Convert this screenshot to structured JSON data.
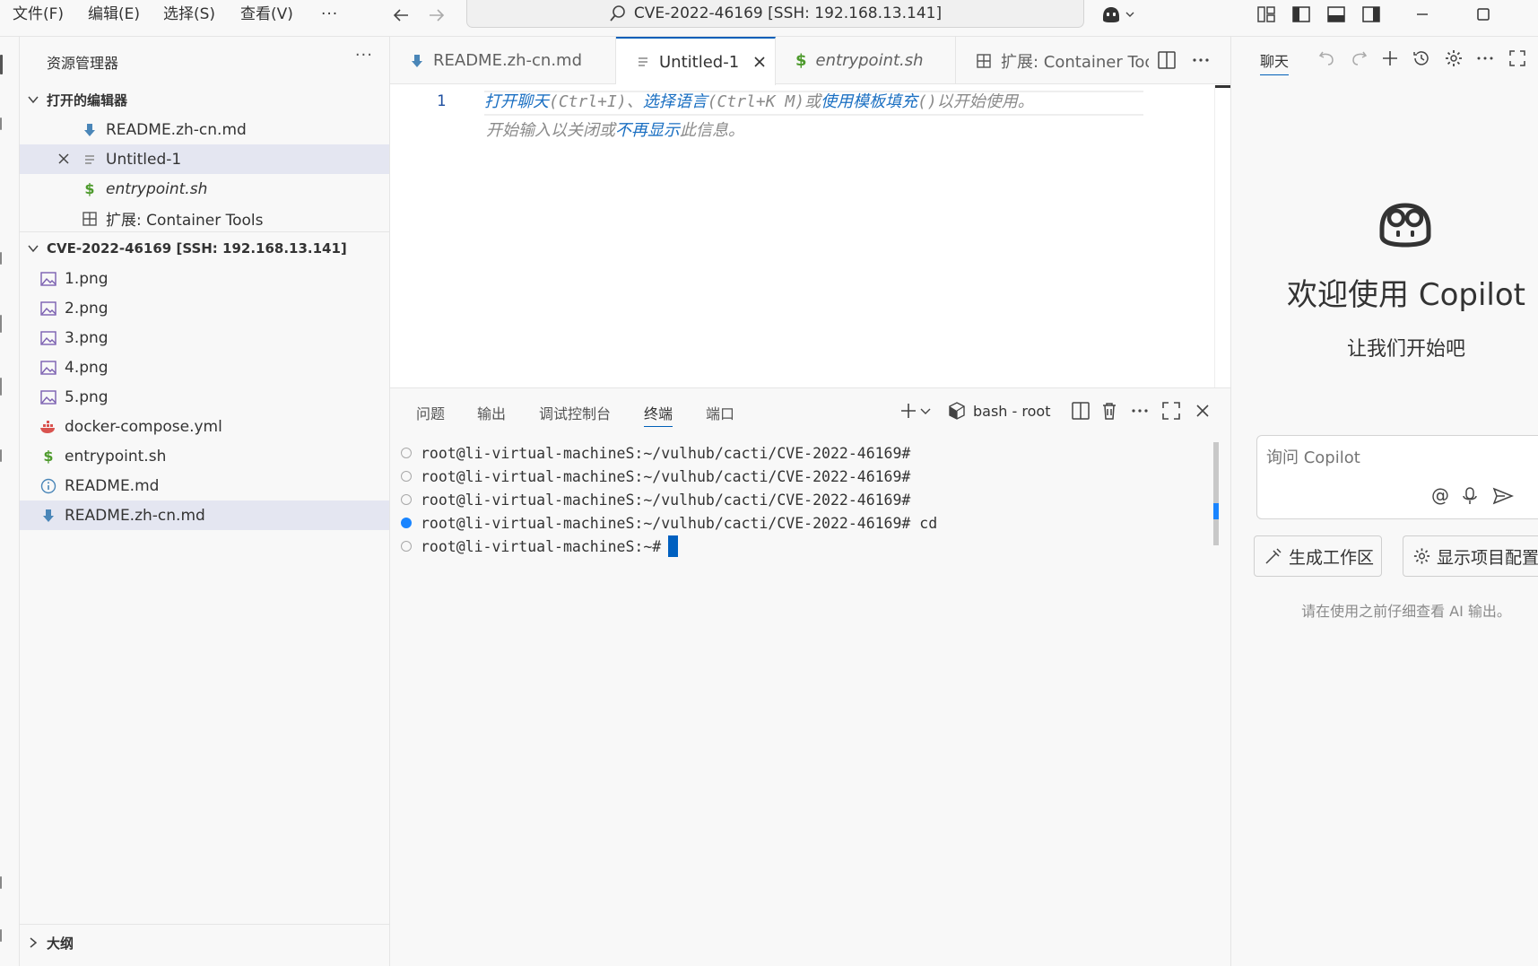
{
  "menu": {
    "file": "文件(F)",
    "edit": "编辑(E)",
    "select": "选择(S)",
    "view": "查看(V)",
    "more": "···"
  },
  "command_center": {
    "label": "CVE-2022-46169 [SSH: 192.168.13.141]"
  },
  "sidebar": {
    "title": "资源管理器",
    "more": "···",
    "open_editors": {
      "header": "打开的编辑器",
      "items": [
        {
          "label": "README.zh-cn.md",
          "icon": "markdown-download-icon"
        },
        {
          "label": "Untitled-1",
          "icon": "plain-text-icon"
        },
        {
          "label": "entrypoint.sh",
          "icon": "shell-dollar-icon"
        },
        {
          "label": "扩展: Container Tools",
          "icon": "extensions-icon"
        }
      ]
    },
    "workspace": {
      "header": "CVE-2022-46169 [SSH: 192.168.13.141]",
      "files": [
        {
          "label": "1.png",
          "icon": "image-icon"
        },
        {
          "label": "2.png",
          "icon": "image-icon"
        },
        {
          "label": "3.png",
          "icon": "image-icon"
        },
        {
          "label": "4.png",
          "icon": "image-icon"
        },
        {
          "label": "5.png",
          "icon": "image-icon"
        },
        {
          "label": "docker-compose.yml",
          "icon": "docker-icon"
        },
        {
          "label": "entrypoint.sh",
          "icon": "shell-dollar-icon"
        },
        {
          "label": "README.md",
          "icon": "info-icon"
        },
        {
          "label": "README.zh-cn.md",
          "icon": "markdown-download-icon"
        }
      ]
    },
    "outline": {
      "header": "大纲"
    }
  },
  "editor": {
    "tabs": [
      {
        "label": "README.zh-cn.md",
        "active": false
      },
      {
        "label": "Untitled-1",
        "active": true
      },
      {
        "label": "entrypoint.sh",
        "active": false
      },
      {
        "label": "扩展: Container Too",
        "active": false
      }
    ],
    "line_number": "1",
    "hint": {
      "open_chat": "打开聊天",
      "open_chat_key": "(Ctrl+I)、",
      "select_lang": "选择语言",
      "select_lang_key": "(Ctrl+K M)或",
      "use_template": "使用模板填充",
      "template_suffix": "()以开始使用。",
      "line2_prefix": "开始输入以关闭或",
      "dont_show": "不再显示",
      "line2_suffix": "此信息。"
    }
  },
  "panel": {
    "tabs": {
      "problems": "问题",
      "output": "输出",
      "debug_console": "调试控制台",
      "terminal": "终端",
      "ports": "端口"
    },
    "terminal_profile": "bash - root",
    "lines": [
      {
        "text": "root@li-virtual-machineS:~/vulhub/cacti/CVE-2022-46169#",
        "active": false
      },
      {
        "text": "root@li-virtual-machineS:~/vulhub/cacti/CVE-2022-46169#",
        "active": false
      },
      {
        "text": "root@li-virtual-machineS:~/vulhub/cacti/CVE-2022-46169#",
        "active": false
      },
      {
        "text": "root@li-virtual-machineS:~/vulhub/cacti/CVE-2022-46169# cd",
        "active": true
      },
      {
        "text": "root@li-virtual-machineS:~#",
        "active": false
      }
    ]
  },
  "chat": {
    "tab": "聊天",
    "welcome_title": "欢迎使用 Copilot",
    "welcome_sub": "让我们开始吧",
    "input_placeholder": "询问 Copilot",
    "generate_workspace": "生成工作区",
    "show_config": "显示项目配置",
    "disclaimer": "请在使用之前仔细查看 AI 输出。"
  },
  "colors": {
    "accent": "#005fb8",
    "selection": "#e4e6f1",
    "terminal_active_dot": "#1a85ff"
  }
}
